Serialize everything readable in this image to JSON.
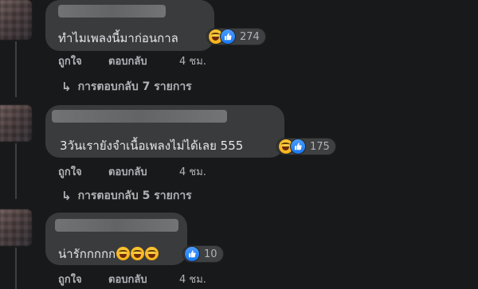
{
  "comments": [
    {
      "text": "ทำไมเพลงนี้มาก่อนกาล",
      "reaction_count": "274",
      "like_label": "ถูกใจ",
      "reply_label": "ตอบกลับ",
      "time": "4 ชม.",
      "replies_label": "การตอบกลับ 7 รายการ"
    },
    {
      "text": "3วันเรายังจำเนื้อเพลงไม่ได้เลย 555",
      "reaction_count": "175",
      "like_label": "ถูกใจ",
      "reply_label": "ตอบกลับ",
      "time": "4 ชม.",
      "replies_label": "การตอบกลับ 5 รายการ"
    },
    {
      "text": "น่ารักกกกก",
      "reaction_count": "10",
      "like_label": "ถูกใจ",
      "reply_label": "ตอบกลับ",
      "time": "4 ชม."
    }
  ],
  "icons": {
    "reply_arrow": "↳",
    "haha_reaction": "haha-icon",
    "like_reaction": "like-icon",
    "rofl_emoji": "rofl-emoji-icon"
  },
  "colors": {
    "background": "#18191a",
    "bubble": "#3a3b3c",
    "text": "#e4e6eb",
    "secondary_text": "#b0b3b8",
    "like_blue": "#1877f2"
  }
}
